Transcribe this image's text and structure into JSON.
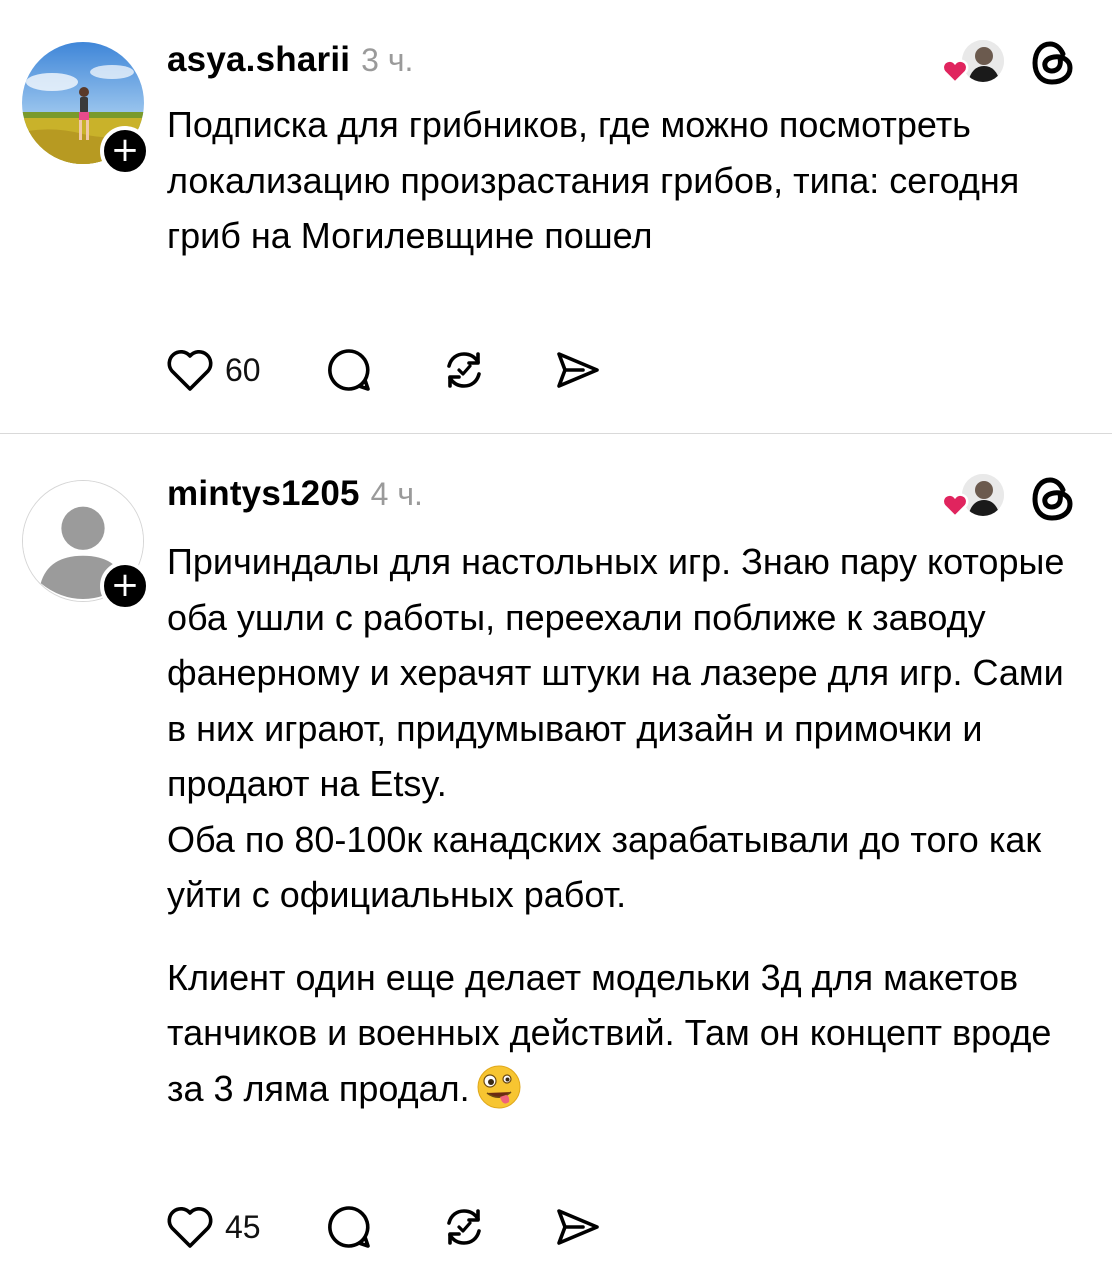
{
  "posts": [
    {
      "username": "asya.sharii",
      "time": "3 ч.",
      "avatar": "photo-avatar",
      "follow_label": "+",
      "paragraphs": [
        "Подписка для грибников, где можно посмотреть локализацию произрастания грибов, типа: сегодня гриб на Могилевщине пошел"
      ],
      "likes": "60",
      "icons": [
        "heart-icon",
        "comment-icon",
        "repost-icon",
        "share-icon",
        "threads-icon"
      ]
    },
    {
      "username": "mintys1205",
      "time": "4 ч.",
      "avatar": "default-avatar",
      "follow_label": "+",
      "paragraphs": [
        "Причиндалы для настольных игр. Знаю пару которые оба ушли с работы, переехали поближе к заводу фанерному и херачят штуки на лазере для игр. Сами в них играют, придумывают дизайн и примочки и продают на Etsy.",
        "Оба по 80-100к канадских зарабатывали до того как уйти с официальных работ.",
        "Клиент один еще делает модельки 3д для макетов танчиков и военных действий. Там он концепт вроде за 3 ляма продал."
      ],
      "emoji": "zany-face-emoji",
      "likes": "45",
      "icons": [
        "heart-icon",
        "comment-icon",
        "repost-icon",
        "share-icon",
        "threads-icon"
      ]
    }
  ],
  "colors": {
    "text": "#000000",
    "muted": "#9a9a9a",
    "divider": "#d9d9d9",
    "heart": "#e0245e"
  }
}
